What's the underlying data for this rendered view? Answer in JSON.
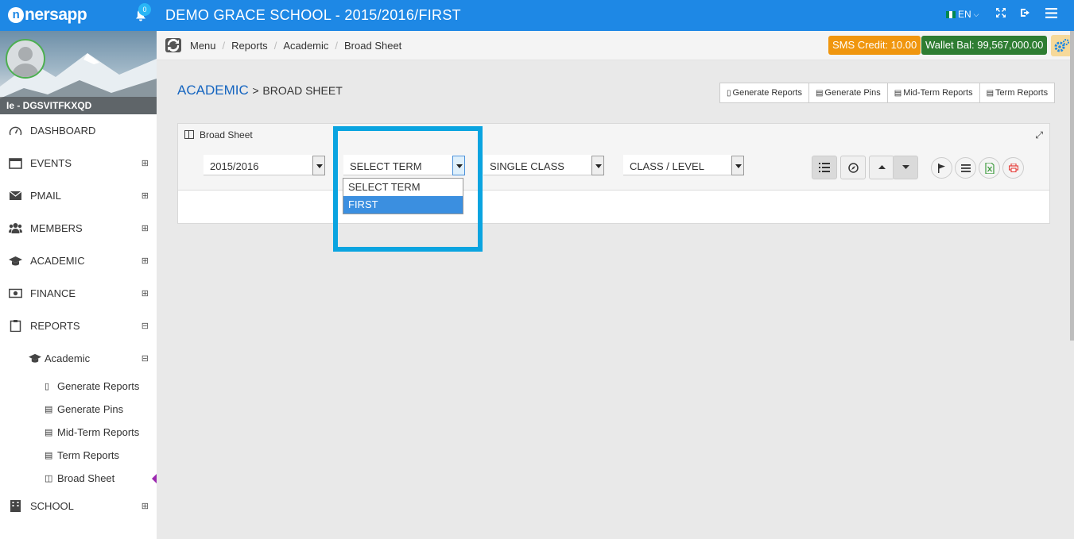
{
  "topbar": {
    "logo": "nersapp",
    "notifications_count": "0",
    "title": "DEMO GRACE SCHOOL - 2015/2016/FIRST",
    "language": "EN"
  },
  "sidebar": {
    "username": "Ie - DGSVITFKXQD",
    "items": [
      {
        "label": "DASHBOARD",
        "icon": "dashboard-icon",
        "expander": ""
      },
      {
        "label": "EVENTS",
        "icon": "calendar-icon",
        "expander": "⊞"
      },
      {
        "label": "PMAIL",
        "icon": "mail-icon",
        "expander": "⊞"
      },
      {
        "label": "MEMBERS",
        "icon": "users-icon",
        "expander": "⊞"
      },
      {
        "label": "ACADEMIC",
        "icon": "graduation-cap-icon",
        "expander": "⊞"
      },
      {
        "label": "FINANCE",
        "icon": "money-icon",
        "expander": "⊞"
      },
      {
        "label": "REPORTS",
        "icon": "clipboard-icon",
        "expander": "⊟"
      }
    ],
    "reports_sub": {
      "label": "Academic",
      "expander": "⊟"
    },
    "report_leaves": [
      "Generate Reports",
      "Generate Pins",
      "Mid-Term Reports",
      "Term Reports",
      "Broad Sheet"
    ],
    "school": {
      "label": "SCHOOL",
      "expander": "⊞"
    }
  },
  "breadcrumb": [
    "Menu",
    "Reports",
    "Academic",
    "Broad Sheet"
  ],
  "badges": {
    "sms_credit": "SMS Credit: 10.00",
    "wallet": "Wallet Bal: 99,567,000.00",
    "sms_color": "#f0960e",
    "wallet_color": "#2e7d32"
  },
  "page": {
    "title_main": "ACADEMIC",
    "title_sep": ">",
    "title_sub": "BROAD SHEET",
    "buttons": [
      "Generate Reports",
      "Generate Pins",
      "Mid-Term Reports",
      "Term Reports"
    ]
  },
  "panel": {
    "title": "Broad Sheet",
    "session_select": "2015/2016",
    "term_select": "SELECT TERM",
    "class_mode_select": "SINGLE CLASS",
    "class_level_select": "CLASS / LEVEL",
    "term_options": [
      "SELECT TERM",
      "FIRST"
    ],
    "term_highlighted": "FIRST"
  },
  "colors": {
    "topbar": "#1e88e5",
    "accent": "#1565c0",
    "highlight_box": "#0aa4e0"
  }
}
